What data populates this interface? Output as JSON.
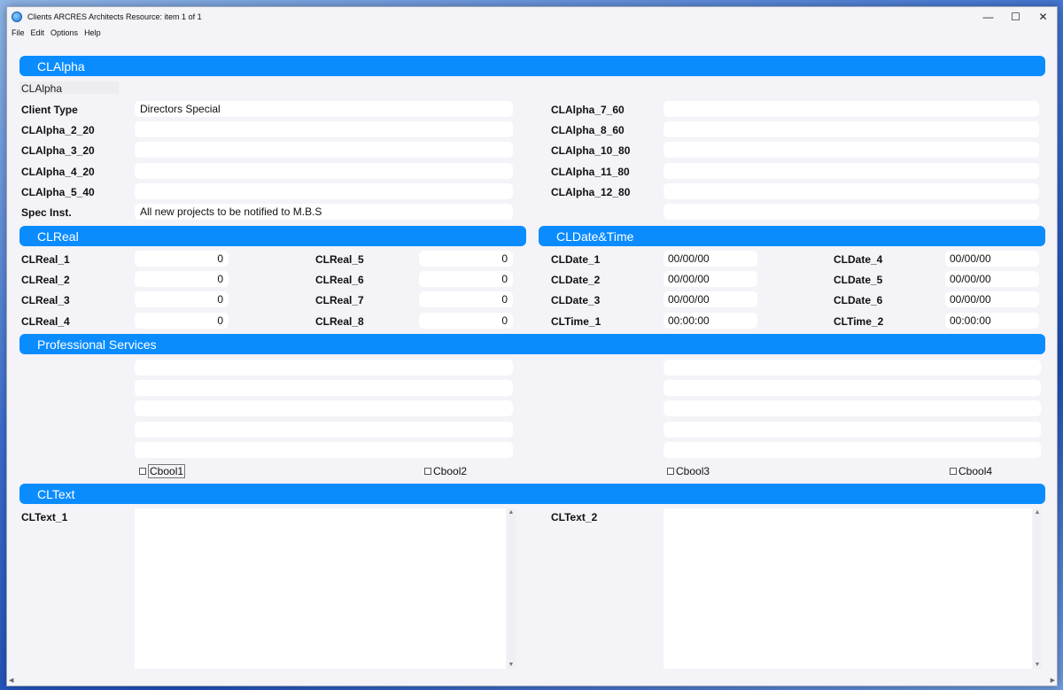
{
  "window": {
    "title": "Clients ARCRES Architects Resource: item 1  of  1",
    "controls": {
      "minimize": "—",
      "maximize": "☐",
      "close": "✕"
    }
  },
  "menu": [
    "File",
    "Edit",
    "Options",
    "Help"
  ],
  "sections": {
    "alpha": "CLAlpha",
    "real": "CLReal",
    "datetime": "CLDate&Time",
    "prof": "Professional Services",
    "text": "CLText"
  },
  "alpha": {
    "sublabel": "CLAlpha",
    "left": [
      {
        "label": "Client Type",
        "value": "Directors Special"
      },
      {
        "label": "CLAlpha_2_20",
        "value": ""
      },
      {
        "label": "CLAlpha_3_20",
        "value": ""
      },
      {
        "label": "CLAlpha_4_20",
        "value": ""
      },
      {
        "label": "CLAlpha_5_40",
        "value": ""
      },
      {
        "label": "Spec Inst.",
        "value": "All new projects to be notified to M.B.S"
      }
    ],
    "right": [
      {
        "label": "CLAlpha_7_60",
        "value": ""
      },
      {
        "label": "CLAlpha_8_60",
        "value": ""
      },
      {
        "label": "CLAlpha_10_80",
        "value": ""
      },
      {
        "label": "CLAlpha_11_80",
        "value": ""
      },
      {
        "label": "CLAlpha_12_80",
        "value": ""
      },
      {
        "label": "",
        "value": ""
      }
    ]
  },
  "real": {
    "col1": [
      {
        "label": "CLReal_1",
        "value": "0"
      },
      {
        "label": "CLReal_2",
        "value": "0"
      },
      {
        "label": "CLReal_3",
        "value": "0"
      },
      {
        "label": "CLReal_4",
        "value": "0"
      }
    ],
    "col2": [
      {
        "label": "CLReal_5",
        "value": "0"
      },
      {
        "label": "CLReal_6",
        "value": "0"
      },
      {
        "label": "CLReal_7",
        "value": "0"
      },
      {
        "label": "CLReal_8",
        "value": "0"
      }
    ]
  },
  "datetime": {
    "col1": [
      {
        "label": "CLDate_1",
        "value": "00/00/00"
      },
      {
        "label": "CLDate_2",
        "value": "00/00/00"
      },
      {
        "label": "CLDate_3",
        "value": "00/00/00"
      },
      {
        "label": "CLTime_1",
        "value": "00:00:00"
      }
    ],
    "col2": [
      {
        "label": "CLDate_4",
        "value": "00/00/00"
      },
      {
        "label": "CLDate_5",
        "value": "00/00/00"
      },
      {
        "label": "CLDate_6",
        "value": "00/00/00"
      },
      {
        "label": "CLTime_2",
        "value": "00:00:00"
      }
    ]
  },
  "prof": {
    "left_values": [
      "",
      "",
      "",
      "",
      ""
    ],
    "right_values": [
      "",
      "",
      "",
      "",
      ""
    ],
    "checkboxes": [
      "Cbool1",
      "Cbool2",
      "Cbool3",
      "Cbool4"
    ]
  },
  "text": {
    "label1": "CLText_1",
    "label2": "CLText_2",
    "value1": "",
    "value2": ""
  },
  "icons": {
    "scroll_up": "▲",
    "scroll_down": "▼",
    "scroll_left": "◀",
    "scroll_right": "▶"
  }
}
